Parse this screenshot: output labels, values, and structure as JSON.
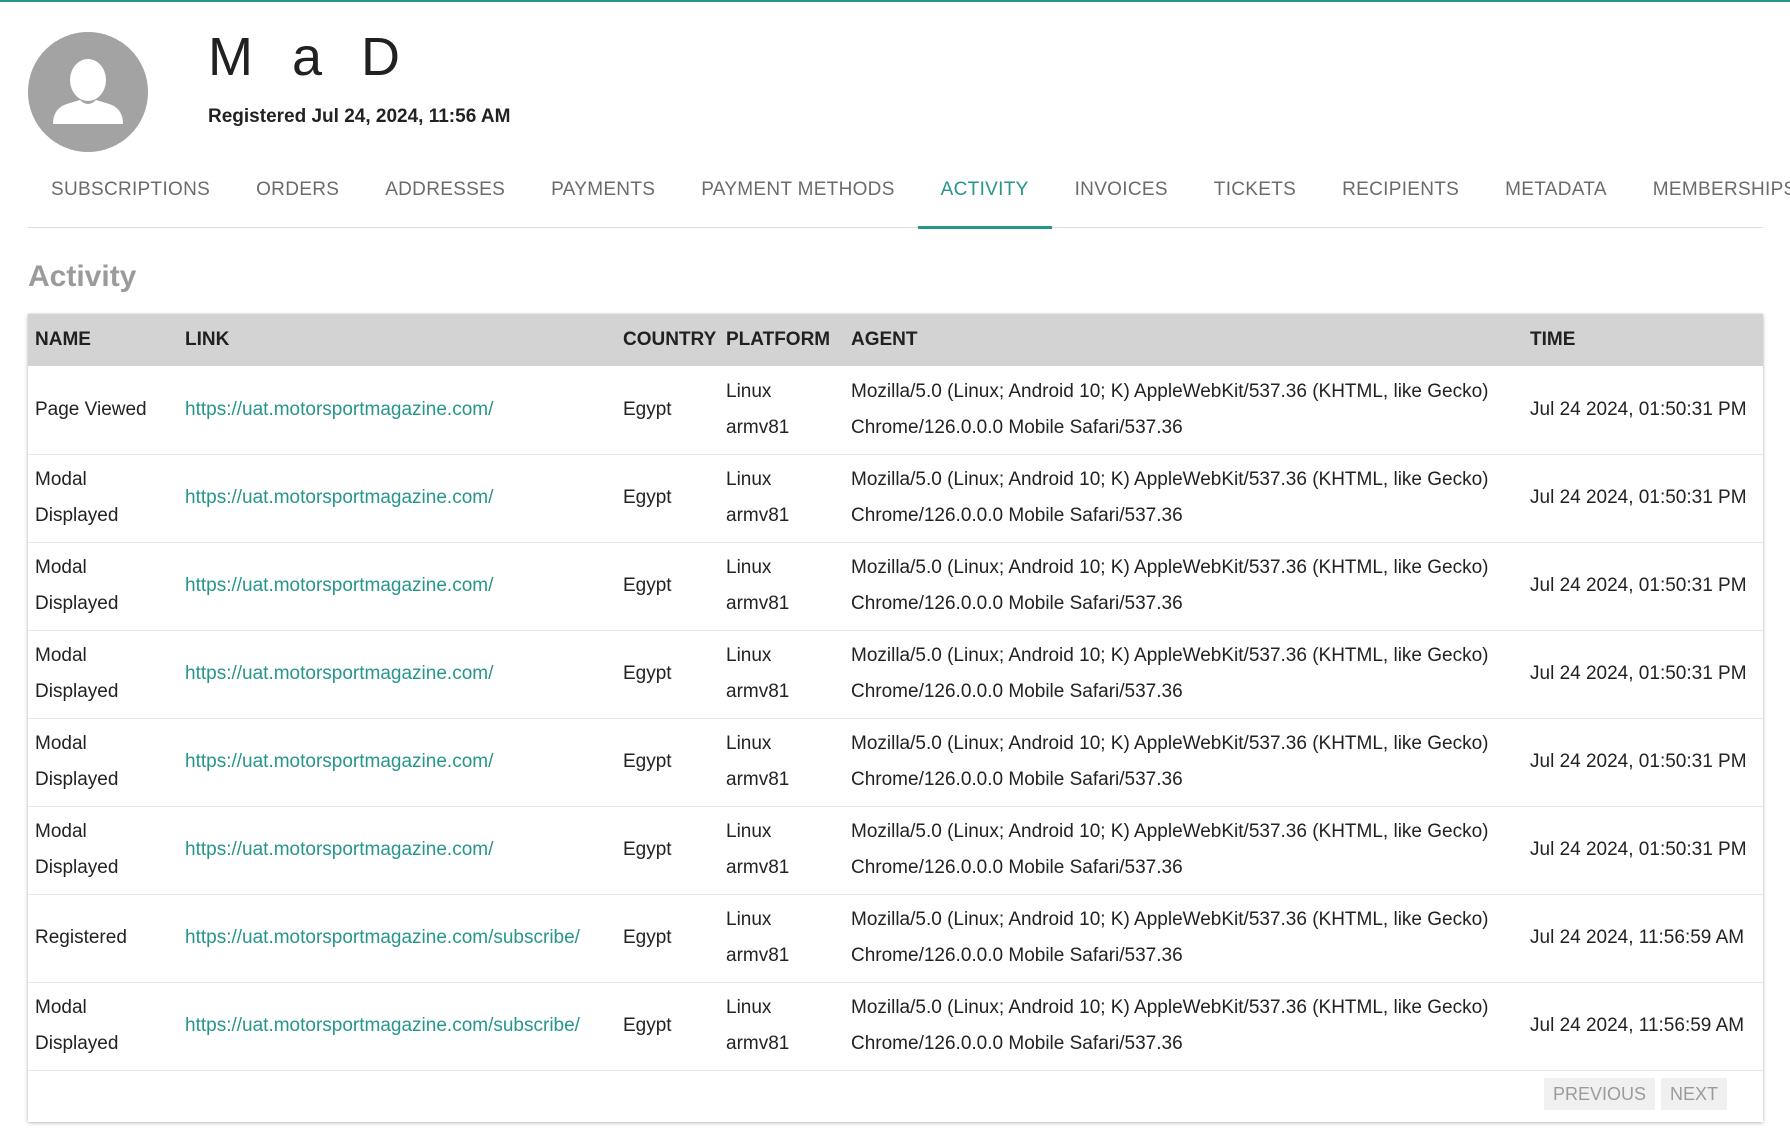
{
  "profile": {
    "name": "M a D",
    "registered": "Registered Jul 24, 2024, 11:56 AM"
  },
  "tabs": [
    {
      "label": "SUBSCRIPTIONS",
      "active": false
    },
    {
      "label": "ORDERS",
      "active": false
    },
    {
      "label": "ADDRESSES",
      "active": false
    },
    {
      "label": "PAYMENTS",
      "active": false
    },
    {
      "label": "PAYMENT METHODS",
      "active": false
    },
    {
      "label": "ACTIVITY",
      "active": true
    },
    {
      "label": "INVOICES",
      "active": false
    },
    {
      "label": "TICKETS",
      "active": false
    },
    {
      "label": "RECIPIENTS",
      "active": false
    },
    {
      "label": "METADATA",
      "active": false
    },
    {
      "label": "MEMBERSHIPS",
      "active": false
    }
  ],
  "activity": {
    "title": "Activity",
    "columns": [
      "NAME",
      "LINK",
      "COUNTRY",
      "PLATFORM",
      "AGENT",
      "TIME"
    ],
    "rows": [
      {
        "name": "Page Viewed",
        "link": "https://uat.motorsportmagazine.com/",
        "country": "Egypt",
        "platform": "Linux armv81",
        "agent": "Mozilla/5.0 (Linux; Android 10; K) AppleWebKit/537.36 (KHTML, like Gecko) Chrome/126.0.0.0 Mobile Safari/537.36",
        "time": "Jul 24 2024, 01:50:31 PM"
      },
      {
        "name": "Modal Displayed",
        "link": "https://uat.motorsportmagazine.com/",
        "country": "Egypt",
        "platform": "Linux armv81",
        "agent": "Mozilla/5.0 (Linux; Android 10; K) AppleWebKit/537.36 (KHTML, like Gecko) Chrome/126.0.0.0 Mobile Safari/537.36",
        "time": "Jul 24 2024, 01:50:31 PM"
      },
      {
        "name": "Modal Displayed",
        "link": "https://uat.motorsportmagazine.com/",
        "country": "Egypt",
        "platform": "Linux armv81",
        "agent": "Mozilla/5.0 (Linux; Android 10; K) AppleWebKit/537.36 (KHTML, like Gecko) Chrome/126.0.0.0 Mobile Safari/537.36",
        "time": "Jul 24 2024, 01:50:31 PM"
      },
      {
        "name": "Modal Displayed",
        "link": "https://uat.motorsportmagazine.com/",
        "country": "Egypt",
        "platform": "Linux armv81",
        "agent": "Mozilla/5.0 (Linux; Android 10; K) AppleWebKit/537.36 (KHTML, like Gecko) Chrome/126.0.0.0 Mobile Safari/537.36",
        "time": "Jul 24 2024, 01:50:31 PM"
      },
      {
        "name": "Modal Displayed",
        "link": "https://uat.motorsportmagazine.com/",
        "country": "Egypt",
        "platform": "Linux armv81",
        "agent": "Mozilla/5.0 (Linux; Android 10; K) AppleWebKit/537.36 (KHTML, like Gecko) Chrome/126.0.0.0 Mobile Safari/537.36",
        "time": "Jul 24 2024, 01:50:31 PM"
      },
      {
        "name": "Modal Displayed",
        "link": "https://uat.motorsportmagazine.com/",
        "country": "Egypt",
        "platform": "Linux armv81",
        "agent": "Mozilla/5.0 (Linux; Android 10; K) AppleWebKit/537.36 (KHTML, like Gecko) Chrome/126.0.0.0 Mobile Safari/537.36",
        "time": "Jul 24 2024, 01:50:31 PM"
      },
      {
        "name": "Registered",
        "link": "https://uat.motorsportmagazine.com/subscribe/",
        "country": "Egypt",
        "platform": "Linux armv81",
        "agent": "Mozilla/5.0 (Linux; Android 10; K) AppleWebKit/537.36 (KHTML, like Gecko) Chrome/126.0.0.0 Mobile Safari/537.36",
        "time": "Jul 24 2024, 11:56:59 AM"
      },
      {
        "name": "Modal Displayed",
        "link": "https://uat.motorsportmagazine.com/subscribe/",
        "country": "Egypt",
        "platform": "Linux armv81",
        "agent": "Mozilla/5.0 (Linux; Android 10; K) AppleWebKit/537.36 (KHTML, like Gecko) Chrome/126.0.0.0 Mobile Safari/537.36",
        "time": "Jul 24 2024, 11:56:59 AM"
      }
    ]
  },
  "pagination": {
    "previous_label": "PREVIOUS",
    "next_label": "NEXT"
  },
  "colors": {
    "accent": "#26968b",
    "avatar_bg": "#a3a3a3",
    "header_row": "#d3d3d3"
  },
  "icons": {
    "avatar": "person-silhouette-icon"
  }
}
